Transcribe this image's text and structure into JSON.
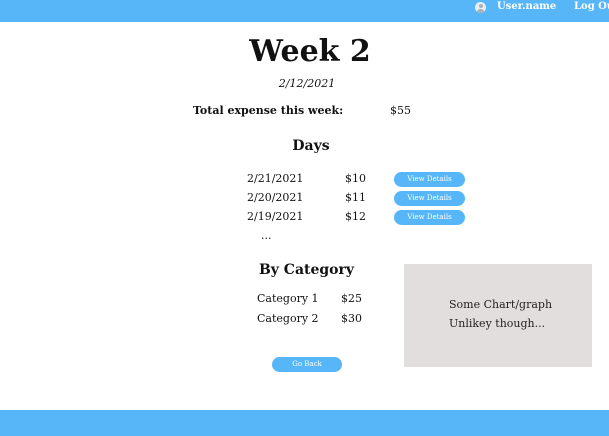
{
  "header": {
    "username": "User.name",
    "logout_label": "Log Out"
  },
  "page": {
    "title": "Week 2",
    "date": "2/12/2021",
    "total_label": "Total expense this week:",
    "total_value": "$55"
  },
  "days": {
    "heading": "Days",
    "items": [
      {
        "date": "2/21/2021",
        "amount": "$10",
        "button_label": "View Details"
      },
      {
        "date": "2/20/2021",
        "amount": "$11",
        "button_label": "View Details"
      },
      {
        "date": "2/19/2021",
        "amount": "$12",
        "button_label": "View Details"
      }
    ],
    "more": "..."
  },
  "category": {
    "heading": "By Category",
    "items": [
      {
        "name": "Category 1",
        "amount": "$25"
      },
      {
        "name": "Category 2",
        "amount": "$30"
      }
    ]
  },
  "chart_placeholder": {
    "line1": "Some Chart/graph",
    "line2": "Unlikey though..."
  },
  "footer": {
    "go_back_label": "Go Back"
  },
  "colors": {
    "accent": "#56b6f7",
    "chart_box": "#e2dedd"
  },
  "icons": {
    "user": "user-avatar-icon"
  }
}
